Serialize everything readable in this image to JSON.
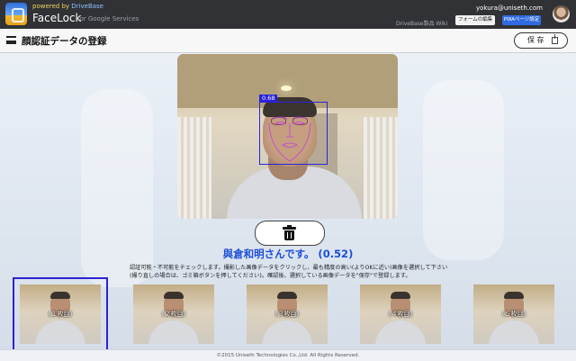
{
  "header": {
    "powered_prefix": "powered by",
    "powered_brand": "DriveBase",
    "app_name": "FaceLock",
    "app_sub": "for Google Services",
    "user_email": "yokura@uniseth.com",
    "wiki_link": "DriveBase製品 Wiki",
    "form_edit_button": "フォームの編集",
    "pwa_button": "PWAページ設定"
  },
  "titlebar": {
    "title": "顔認証データの登録",
    "save_label": "保 存"
  },
  "preview": {
    "confidence_label": "0.68"
  },
  "result": {
    "recognized_text": "與倉和明さんです。 (0.52)"
  },
  "instructions": {
    "text": "認証可能・不可能をチェックします。撮影した画像データをクリックし、最も精度の高い(よりOKに近い)画像を選択して下さい(撮り直しの場合は、ゴミ箱ボタンを押してください)。確認後、選択している画像データを\"保存\"で登録します。"
  },
  "thumbnails": [
    {
      "label": "（１枚目）",
      "selected": true
    },
    {
      "label": "（２枚目）",
      "selected": false
    },
    {
      "label": "（３枚目）",
      "selected": false
    },
    {
      "label": "（４枚目）",
      "selected": false
    },
    {
      "label": "（５枚目）",
      "selected": false
    }
  ],
  "footer": {
    "copyright": "©2015 Uniseth Technologies Co.,Ltd. All Rights Reserved."
  },
  "colors": {
    "accent": "#2b22d6",
    "name_text": "#1d4fd8",
    "topbar": "#303236",
    "pwa_button": "#2f6bdf"
  }
}
